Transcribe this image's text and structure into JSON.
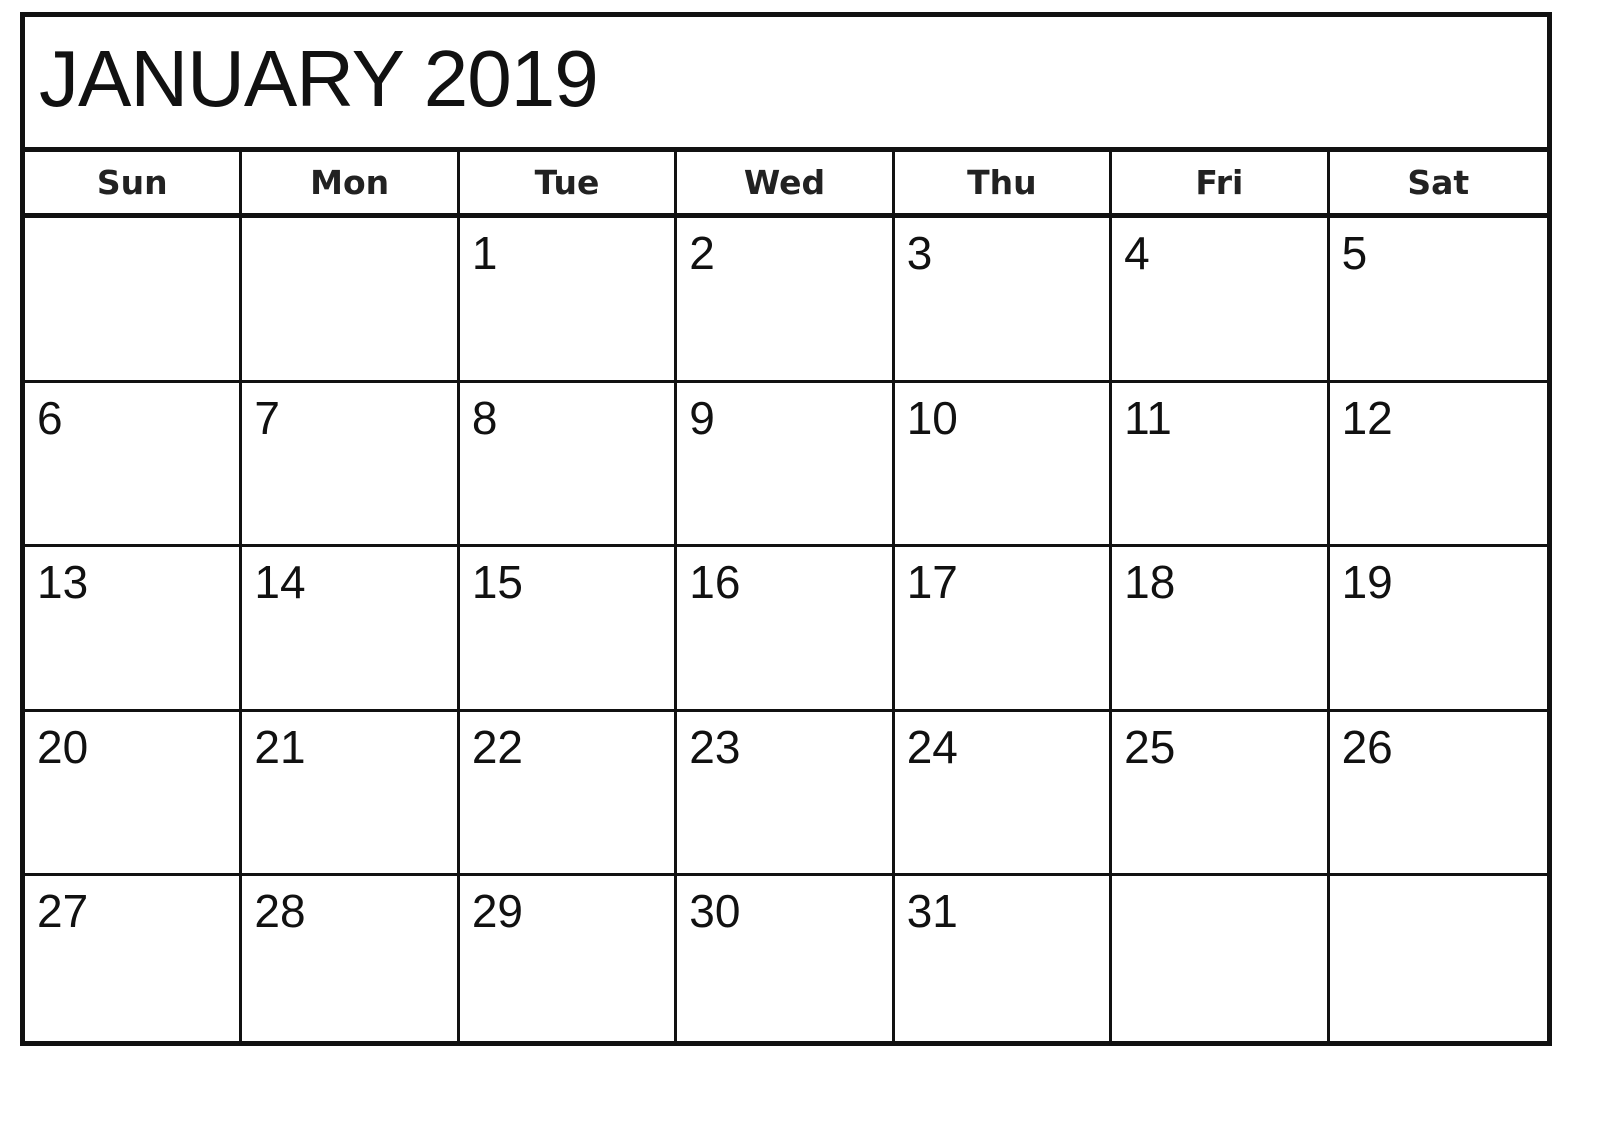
{
  "calendar": {
    "title": "JANUARY 2019",
    "weekdays": [
      "Sun",
      "Mon",
      "Tue",
      "Wed",
      "Thu",
      "Fri",
      "Sat"
    ],
    "weeks": [
      [
        "",
        "",
        "1",
        "2",
        "3",
        "4",
        "5"
      ],
      [
        "6",
        "7",
        "8",
        "9",
        "10",
        "11",
        "12"
      ],
      [
        "13",
        "14",
        "15",
        "16",
        "17",
        "18",
        "19"
      ],
      [
        "20",
        "21",
        "22",
        "23",
        "24",
        "25",
        "26"
      ],
      [
        "27",
        "28",
        "29",
        "30",
        "31",
        "",
        ""
      ]
    ]
  }
}
